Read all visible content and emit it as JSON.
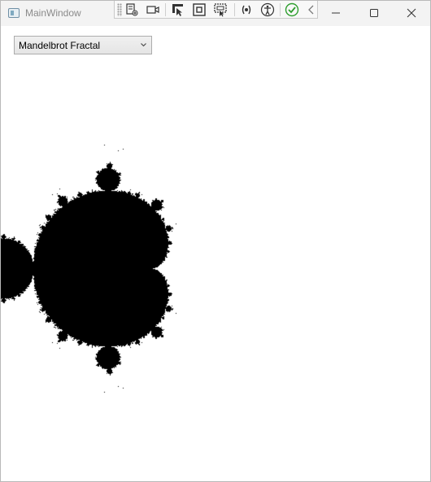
{
  "window": {
    "title": "MainWindow",
    "caption_buttons": [
      "minimize-icon",
      "maximize-icon",
      "close-icon"
    ]
  },
  "debug_toolbar": {
    "icons": [
      "live-visual-tree-icon",
      "video-record-icon",
      "select-element-icon",
      "display-layout-adorners-icon",
      "track-focus-icon",
      "binding-failures-icon",
      "accessibility-icon",
      "accessibility-checks-ok-icon",
      "collapse-toolbar-icon"
    ],
    "accent_green": "#2e9e2e"
  },
  "combo": {
    "selected": "Mandelbrot Fractal"
  },
  "fractal": {
    "name": "Mandelbrot",
    "fill_color": "#000000",
    "background": "#ffffff"
  }
}
